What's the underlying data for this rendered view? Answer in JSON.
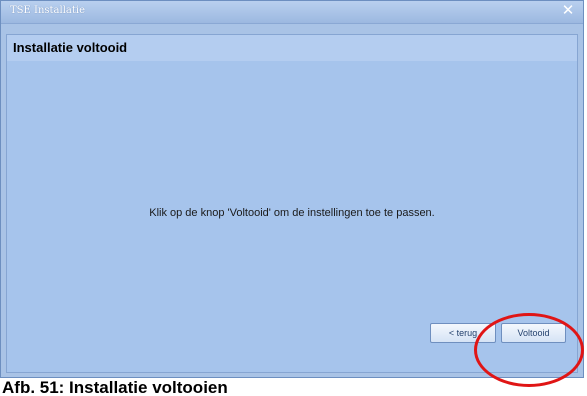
{
  "window": {
    "title": "TSE Installatie",
    "close_symbol": "✕"
  },
  "content": {
    "heading": "Installatie voltooid",
    "message": "Klik op de knop 'Voltooid' om de instellingen toe te passen."
  },
  "buttons": {
    "back_label": "< terug",
    "finish_label": "Voltooid"
  },
  "caption": "Afb. 51: Installatie voltooien",
  "colors": {
    "window_bg": "#a9c3e6",
    "highlight_circle": "#e01515"
  }
}
